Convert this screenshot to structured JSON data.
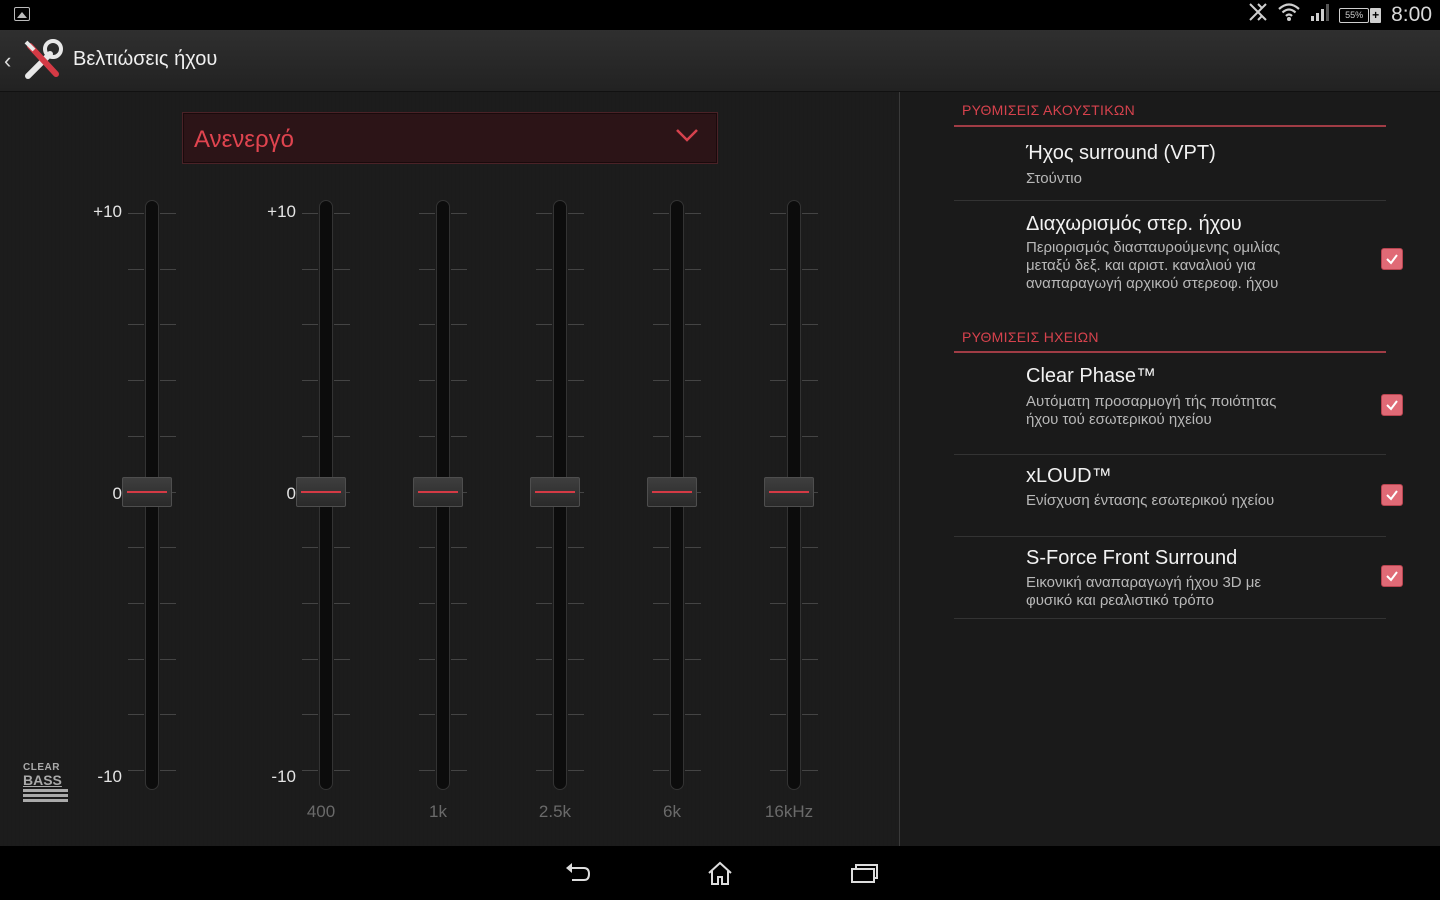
{
  "status_bar": {
    "battery": "55%",
    "time": "8:00",
    "icons": [
      "gallery-notification-icon",
      "nfc-off-icon",
      "wifi-icon",
      "signal-icon",
      "battery-icon"
    ]
  },
  "action_bar": {
    "title": "Βελτιώσεις ήχου",
    "icon": "tools-icon"
  },
  "equalizer": {
    "preset": "Ανενεργό",
    "scale_top": "+10",
    "scale_mid": "0",
    "scale_bottom": "-10",
    "bands": [
      {
        "label": "",
        "value": 0
      },
      {
        "label": "400",
        "value": 0
      },
      {
        "label": "1k",
        "value": 0
      },
      {
        "label": "2.5k",
        "value": 0
      },
      {
        "label": "6k",
        "value": 0
      },
      {
        "label": "16kHz",
        "value": 0
      }
    ],
    "clear_bass": {
      "line1": "CLEAR",
      "line2": "BASS"
    }
  },
  "settings": {
    "headphone_header": "ΡΥΘΜΙΣΕΙΣ ΑΚΟΥΣΤΙΚΩΝ",
    "speaker_header": "ΡΥΘΜΙΣΕΙΣ ΗΧΕΙΩΝ",
    "items": [
      {
        "title": "Ήχος surround (VPT)",
        "summary": "Στούντιο"
      },
      {
        "title": "Διαχωρισμός στερ. ήχου",
        "summary": "Περιορισμός διασταυρούμενης ομιλίας μεταξύ δεξ. και αριστ. καναλιού για αναπαραγωγή αρχικού στερεοφ. ήχου",
        "checked": true
      },
      {
        "title": "Clear Phase™",
        "summary": "Αυτόματη προσαρμογή τής ποιότητας ήχου τού εσωτερικού ηχείου",
        "checked": true
      },
      {
        "title": "xLOUD™",
        "summary": "Ενίσχυση έντασης εσωτερικού ηχείου",
        "checked": true
      },
      {
        "title": "S-Force Front Surround",
        "summary": "Εικονική αναπαραγωγή ήχου 3D με φυσικό και ρεαλιστικό τρόπο",
        "checked": true
      }
    ]
  },
  "accent_color": "#d6424d"
}
